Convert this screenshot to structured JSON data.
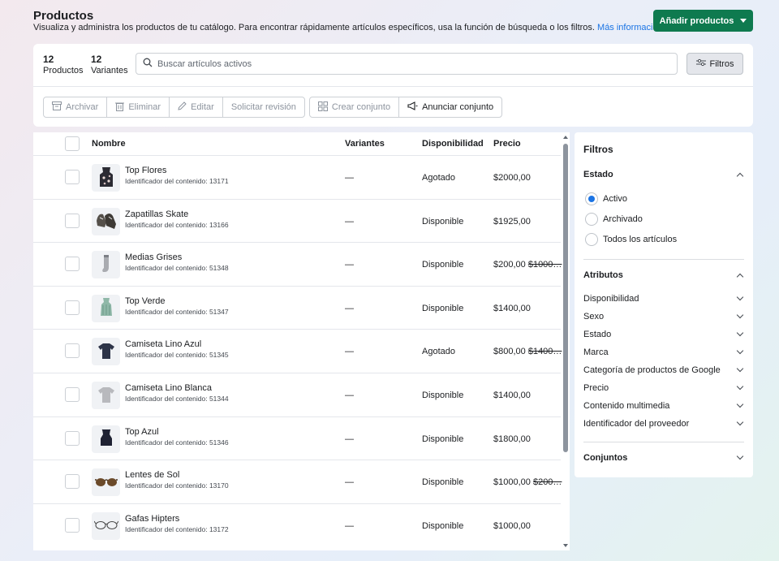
{
  "header": {
    "title": "Productos",
    "subtitle": "Visualiza y administra los productos de tu catálogo. Para encontrar rápidamente artículos específicos, usa la función de búsqueda o los filtros.",
    "more_link": "Más información",
    "add_button": "Añadir productos"
  },
  "counts": {
    "products_value": "12",
    "products_label": "Productos",
    "variants_value": "12",
    "variants_label": "Variantes"
  },
  "search": {
    "placeholder": "Buscar artículos activos"
  },
  "filters_button": "Filtros",
  "toolbar": {
    "archive": "Archivar",
    "delete": "Eliminar",
    "edit": "Editar",
    "request_review": "Solicitar revisión",
    "create_set": "Crear conjunto",
    "advertise_set": "Anunciar conjunto"
  },
  "table": {
    "columns": [
      "Nombre",
      "Variantes",
      "Disponibilidad",
      "Precio"
    ],
    "rows": [
      {
        "name": "Top Flores",
        "id": "Identificador del contenido: 13171",
        "variants": "—",
        "availability": "Agotado",
        "price": "$2000,00",
        "old_price": "",
        "icon": "floral-top-icon"
      },
      {
        "name": "Zapatillas Skate",
        "id": "Identificador del contenido: 13166",
        "variants": "—",
        "availability": "Disponible",
        "price": "$1925,00",
        "old_price": "",
        "icon": "sneakers-icon"
      },
      {
        "name": "Medias Grises",
        "id": "Identificador del contenido: 51348",
        "variants": "—",
        "availability": "Disponible",
        "price": "$200,00",
        "old_price": "$1000…",
        "icon": "socks-icon"
      },
      {
        "name": "Top Verde",
        "id": "Identificador del contenido: 51347",
        "variants": "—",
        "availability": "Disponible",
        "price": "$1400,00",
        "old_price": "",
        "icon": "green-top-icon"
      },
      {
        "name": "Camiseta Lino Azul",
        "id": "Identificador del contenido: 51345",
        "variants": "—",
        "availability": "Agotado",
        "price": "$800,00",
        "old_price": "$1400…",
        "icon": "blue-shirt-icon"
      },
      {
        "name": "Camiseta Lino Blanca",
        "id": "Identificador del contenido: 51344",
        "variants": "—",
        "availability": "Disponible",
        "price": "$1400,00",
        "old_price": "",
        "icon": "white-shirt-icon"
      },
      {
        "name": "Top Azul",
        "id": "Identificador del contenido: 51346",
        "variants": "—",
        "availability": "Disponible",
        "price": "$1800,00",
        "old_price": "",
        "icon": "blue-top-icon"
      },
      {
        "name": "Lentes de Sol",
        "id": "Identificador del contenido: 13170",
        "variants": "—",
        "availability": "Disponible",
        "price": "$1000,00",
        "old_price": "$200…",
        "icon": "sunglasses-icon"
      },
      {
        "name": "Gafas Hipters",
        "id": "Identificador del contenido: 13172",
        "variants": "—",
        "availability": "Disponible",
        "price": "$1000,00",
        "old_price": "",
        "icon": "glasses-icon"
      }
    ]
  },
  "filters": {
    "title": "Filtros",
    "estado": {
      "title": "Estado",
      "options": [
        "Activo",
        "Archivado",
        "Todos los artículos"
      ],
      "selected": "Activo"
    },
    "atributos": {
      "title": "Atributos",
      "items": [
        "Disponibilidad",
        "Sexo",
        "Estado",
        "Marca",
        "Categoría de productos de Google",
        "Precio",
        "Contenido multimedia",
        "Identificador del proveedor"
      ]
    },
    "conjuntos": {
      "title": "Conjuntos"
    }
  },
  "colors": {
    "primary_green": "#0e7a4f",
    "link_blue": "#1b74e4"
  }
}
